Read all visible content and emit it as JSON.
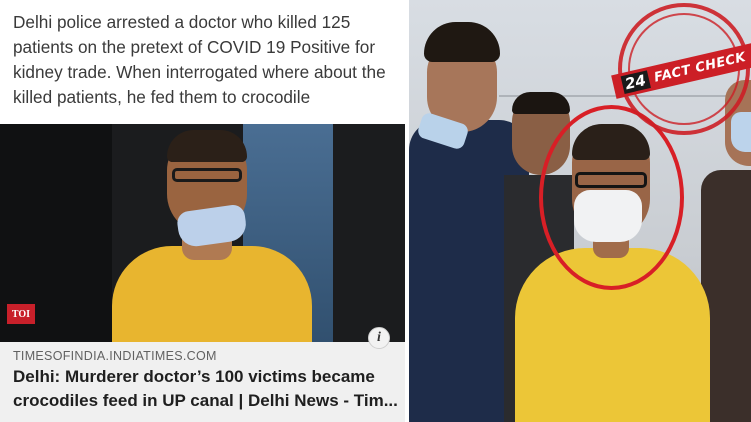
{
  "left_post": {
    "claim_text": "Delhi police arrested a doctor who killed 125 patients on the pretext of COVID 19 Positive for kidney trade. When interrogated where about the killed patients, he fed them to crocodile",
    "image_badge": "TOI",
    "info_icon": "i",
    "link_card": {
      "domain": "TIMESOFINDIA.INDIATIMES.COM",
      "headline": "Delhi: Murderer doctor’s 100 victims became crocodiles feed in UP canal | Delhi News - Tim..."
    }
  },
  "right_photo": {
    "stamp": {
      "logo": "24",
      "label": "FACT CHECK"
    }
  },
  "colors": {
    "stamp_red": "#cc1f26",
    "highlight_circle": "#d81f26",
    "toi_red": "#c8202a",
    "card_bg": "#f0f0f0"
  }
}
